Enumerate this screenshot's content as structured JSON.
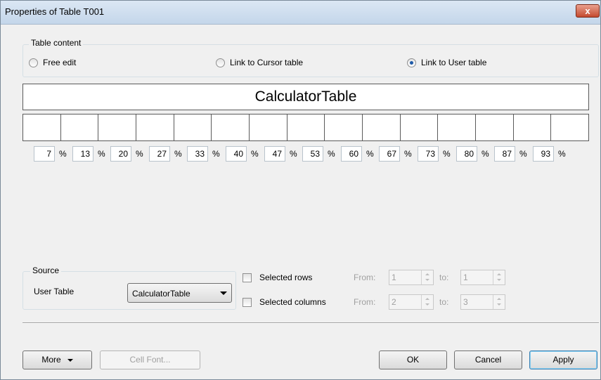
{
  "window": {
    "title": "Properties of Table T001",
    "close_label": "x"
  },
  "table_content": {
    "legend": "Table content",
    "options": [
      {
        "label": "Free edit",
        "checked": false
      },
      {
        "label": "Link to Cursor table",
        "checked": false
      },
      {
        "label": "Link to User table",
        "checked": true
      }
    ]
  },
  "table_preview": {
    "name": "CalculatorTable",
    "column_count": 15,
    "widths": [
      "7",
      "13",
      "20",
      "27",
      "33",
      "40",
      "47",
      "53",
      "60",
      "67",
      "73",
      "80",
      "87",
      "93"
    ],
    "unit": "%"
  },
  "source": {
    "legend": "Source",
    "user_table_label": "User Table",
    "user_table_value": "CalculatorTable"
  },
  "selection": {
    "selected_rows_label": "Selected rows",
    "selected_columns_label": "Selected columns",
    "from_label": "From:",
    "to_label": "to:",
    "rows_from": "1",
    "rows_to": "1",
    "cols_from": "2",
    "cols_to": "3"
  },
  "buttons": {
    "more": "More",
    "cell_font": "Cell Font...",
    "ok": "OK",
    "cancel": "Cancel",
    "apply": "Apply"
  }
}
